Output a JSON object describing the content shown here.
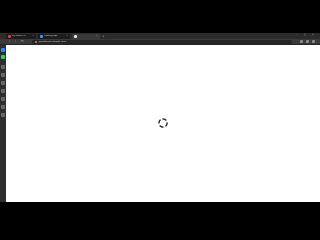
{
  "browser": {
    "tabs": [
      {
        "title": "My Games (2)",
        "favicon_color": "#e0334f",
        "active": false
      },
      {
        "title": "Loading page",
        "favicon_color": "#4f8cff",
        "active": false
      },
      {
        "title": "",
        "favicon_color": "#e8e8e8",
        "active": true
      }
    ],
    "new_tab_label": "+",
    "window_controls": {
      "minimize": "–",
      "maximize": "□",
      "close": "✕"
    },
    "toolbar": {
      "back": "‹",
      "forward": "›",
      "reload": "↻"
    },
    "address": {
      "url": "gamefaucet.example.com/..."
    }
  },
  "sidebar": {
    "items": [
      {
        "icon": "messenger-icon",
        "color": "#2e86ff"
      },
      {
        "icon": "whatsapp-icon",
        "color": "#25d366"
      },
      {
        "icon": "bookmarks-icon",
        "color": "#8a8a8a"
      },
      {
        "icon": "history-icon",
        "color": "#8a8a8a"
      },
      {
        "icon": "downloads-icon",
        "color": "#8a8a8a"
      },
      {
        "icon": "extensions-icon",
        "color": "#8a8a8a"
      },
      {
        "icon": "settings-icon",
        "color": "#8a8a8a"
      },
      {
        "icon": "notes-icon",
        "color": "#8a8a8a"
      },
      {
        "icon": "player-icon",
        "color": "#8a8a8a"
      }
    ]
  },
  "content": {
    "state": "loading",
    "spinner_color": "#222222"
  }
}
